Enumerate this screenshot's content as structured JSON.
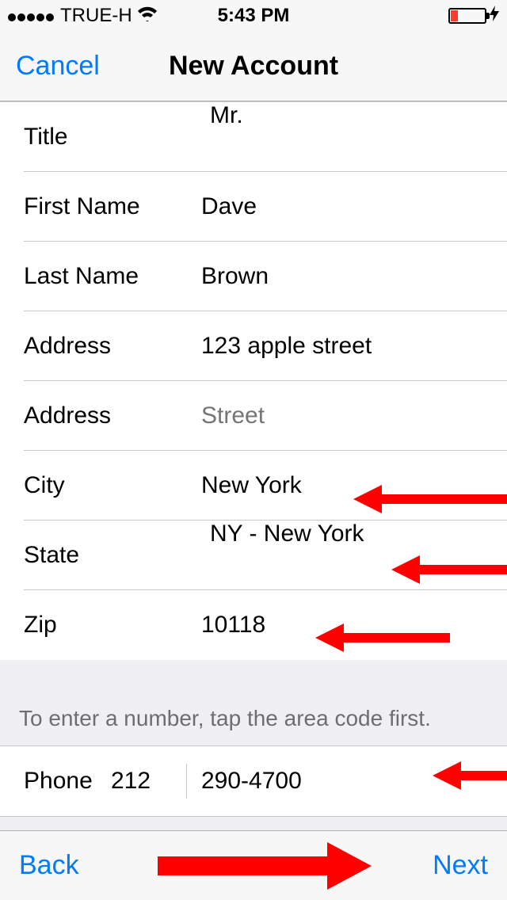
{
  "status": {
    "carrier": "TRUE-H",
    "time": "5:43 PM"
  },
  "navbar": {
    "cancel": "Cancel",
    "title": "New Account"
  },
  "form": {
    "title_label": "Title",
    "title_value": "Mr.",
    "first_name_label": "First Name",
    "first_name_value": "Dave",
    "last_name_label": "Last Name",
    "last_name_value": "Brown",
    "address1_label": "Address",
    "address1_value": "123 apple street",
    "address2_label": "Address",
    "address2_placeholder": "Street",
    "city_label": "City",
    "city_value": "New York",
    "state_label": "State",
    "state_value": "NY - New York",
    "zip_label": "Zip",
    "zip_value": "10118"
  },
  "phone": {
    "hint": "To enter a number, tap the area code first.",
    "label": "Phone",
    "area": "212",
    "number": "290-4700"
  },
  "toolbar": {
    "back": "Back",
    "next": "Next"
  }
}
